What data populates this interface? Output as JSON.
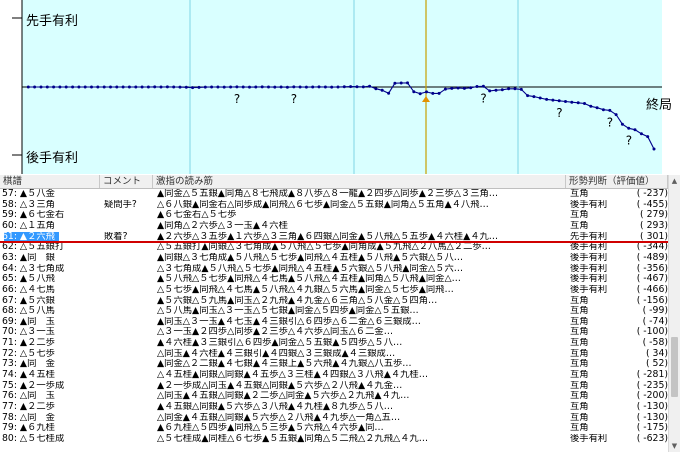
{
  "graph": {
    "top_label": "先手有利",
    "bottom_label": "後手有利",
    "end_label": "終局",
    "question_mark": "?",
    "background_color": "#d9ffff",
    "line_color": "#00008b",
    "points": [
      [
        1,
        0
      ],
      [
        2,
        0
      ],
      [
        3,
        0
      ],
      [
        4,
        0
      ],
      [
        5,
        0
      ],
      [
        6,
        0
      ],
      [
        7,
        0
      ],
      [
        8,
        0
      ],
      [
        9,
        0
      ],
      [
        10,
        0
      ],
      [
        11,
        0
      ],
      [
        12,
        0
      ],
      [
        13,
        0
      ],
      [
        14,
        0
      ],
      [
        15,
        0
      ],
      [
        16,
        0
      ],
      [
        17,
        0
      ],
      [
        18,
        0
      ],
      [
        19,
        0
      ],
      [
        20,
        0
      ],
      [
        21,
        5
      ],
      [
        22,
        0
      ],
      [
        23,
        10
      ],
      [
        24,
        0
      ],
      [
        25,
        -10
      ],
      [
        26,
        -20
      ],
      [
        27,
        -40
      ],
      [
        28,
        -30
      ],
      [
        29,
        -10
      ],
      [
        30,
        0
      ],
      [
        31,
        0
      ],
      [
        32,
        -10
      ],
      [
        33,
        0
      ],
      [
        34,
        5
      ],
      [
        35,
        0
      ],
      [
        36,
        -5
      ],
      [
        37,
        0
      ],
      [
        38,
        10
      ],
      [
        39,
        0
      ],
      [
        40,
        -10
      ],
      [
        41,
        0
      ],
      [
        42,
        -15
      ],
      [
        43,
        5
      ],
      [
        44,
        0
      ],
      [
        45,
        -10
      ],
      [
        46,
        0
      ],
      [
        47,
        10
      ],
      [
        48,
        0
      ],
      [
        49,
        -5
      ],
      [
        50,
        0
      ],
      [
        51,
        15
      ],
      [
        52,
        30
      ],
      [
        53,
        20
      ],
      [
        54,
        10
      ],
      [
        55,
        60
      ],
      [
        56,
        -120
      ],
      [
        57,
        -237
      ],
      [
        58,
        -455
      ],
      [
        59,
        279
      ],
      [
        60,
        293
      ],
      [
        61,
        301
      ],
      [
        62,
        -344
      ],
      [
        63,
        -489
      ],
      [
        64,
        -356
      ],
      [
        65,
        -467
      ],
      [
        66,
        -466
      ],
      [
        67,
        -156
      ],
      [
        68,
        -99
      ],
      [
        69,
        -74
      ],
      [
        70,
        -100
      ],
      [
        71,
        -58
      ],
      [
        72,
        34
      ],
      [
        73,
        52
      ],
      [
        74,
        -281
      ],
      [
        75,
        -235
      ],
      [
        76,
        -200
      ],
      [
        77,
        -130
      ],
      [
        78,
        -130
      ],
      [
        79,
        -175
      ],
      [
        80,
        -623
      ],
      [
        81,
        -700
      ],
      [
        82,
        -800
      ],
      [
        83,
        -900
      ],
      [
        84,
        -950
      ],
      [
        85,
        -1000
      ],
      [
        86,
        -1050
      ],
      [
        87,
        -1100
      ],
      [
        88,
        -1150
      ],
      [
        89,
        -1200
      ],
      [
        90,
        -1400
      ],
      [
        91,
        -1500
      ],
      [
        92,
        -1650
      ],
      [
        93,
        -1700
      ],
      [
        94,
        -2000
      ],
      [
        95,
        -2700
      ],
      [
        96,
        -3000
      ],
      [
        97,
        -3100
      ],
      [
        98,
        -3400
      ],
      [
        99,
        -3600
      ],
      [
        100,
        -4500
      ]
    ],
    "question_marks": [
      [
        34,
        -1
      ],
      [
        43,
        -1
      ],
      [
        73,
        -1
      ],
      [
        85,
        -1
      ],
      [
        93,
        -1
      ],
      [
        96,
        -1
      ]
    ],
    "current_move": 61
  },
  "table": {
    "headers": {
      "move": "棋譜",
      "comment": "コメント",
      "reading": "激指の読み筋",
      "judgement": "形勢判断（評価値）"
    },
    "rows": [
      {
        "move": "57: ▲５八金",
        "comment": "",
        "reading": "▲同金△５五銀▲同角△８七飛成▲８八歩△８一龍▲２四歩△同歩▲２三歩△３三角…",
        "judge": "互角",
        "value": "(  -237)"
      },
      {
        "move": "58: △３三角",
        "comment": "疑問手?",
        "reading": "△６八銀▲同金右△同歩成▲同飛△６七歩▲同金△５五銀▲同角△５五角▲４八飛…",
        "judge": "後手有利",
        "value": "(  -455)"
      },
      {
        "move": "59: ▲６七金右",
        "comment": "",
        "reading": "▲６七金右△５七歩",
        "judge": "互角",
        "value": "(   279)"
      },
      {
        "move": "60: △１五角",
        "comment": "",
        "reading": "▲同角△２六歩△３一玉▲４六桂",
        "judge": "互角",
        "value": "(   293)"
      },
      {
        "move": "61: ▲２六飛",
        "comment": "敗着?",
        "reading": "▲２六歩△３五歩▲１六歩△３三角▲６四銀△同金▲５八飛△５五歩▲４六桂▲４九…",
        "judge": "先手有利",
        "value": "(   301)"
      },
      {
        "move": "62: △５五銀打",
        "comment": "",
        "reading": "△５五銀打▲同銀△３七角成▲５八飛△５七歩▲同角成▲５九飛△２八馬△２二歩…",
        "judge": "後手有利",
        "value": "(  -344)"
      },
      {
        "move": "63: ▲同　銀",
        "comment": "",
        "reading": "▲同銀△３七角成▲５八飛△５七歩▲同飛△４五桂▲５八飛▲５六銀△５八…",
        "judge": "後手有利",
        "value": "(  -489)"
      },
      {
        "move": "64: △３七角成",
        "comment": "",
        "reading": "△３七角成▲５八飛△５七歩▲同飛△４五桂▲５六銀△５八飛▲同金△５六…",
        "judge": "後手有利",
        "value": "(  -356)"
      },
      {
        "move": "65: ▲５八飛",
        "comment": "",
        "reading": "▲５八飛△５七歩▲同飛△４七馬▲５八飛△４五桂▲同角△５八飛▲同金△…",
        "judge": "後手有利",
        "value": "(  -467)"
      },
      {
        "move": "66: △４七馬",
        "comment": "",
        "reading": "△５七歩▲同飛△４七馬▲５八飛△４九銀△５六馬▲同金△５七歩▲同飛…",
        "judge": "後手有利",
        "value": "(  -466)"
      },
      {
        "move": "67: ▲５六銀",
        "comment": "",
        "reading": "▲５六銀△５九馬▲同玉△２九飛▲４九金△６三角△５八金△５四角…",
        "judge": "互角",
        "value": "(  -156)"
      },
      {
        "move": "68: △５八馬",
        "comment": "",
        "reading": "△５八馬▲同玉△３一玉△５七銀▲同金△５四歩▲同金△５五銀…",
        "judge": "互角",
        "value": "(   -99)"
      },
      {
        "move": "69: ▲同　玉",
        "comment": "",
        "reading": "▲同玉△３一玉▲４七玉▲４三銀引△６四歩△６二金△６三銀成…",
        "judge": "互角",
        "value": "(   -74)"
      },
      {
        "move": "70: △３一玉",
        "comment": "",
        "reading": "△３一玉▲２四歩△同歩▲２三歩△４六歩△同玉△６二金…",
        "judge": "互角",
        "value": "(  -100)"
      },
      {
        "move": "71: ▲２二歩",
        "comment": "",
        "reading": "▲４六桂▲３三銀引△６四歩▲同金△５五銀▲５四歩△５八…",
        "judge": "互角",
        "value": "(   -58)"
      },
      {
        "move": "72: △５七歩",
        "comment": "",
        "reading": "△同玉▲４六桂▲４三銀引▲４四銀△３三銀成▲４三銀成…",
        "judge": "互角",
        "value": "(    34)"
      },
      {
        "move": "73: ▲同　金",
        "comment": "",
        "reading": "▲同金△２二銀▲４七銀▲４三銀上▲５六飛▲４九銀△八五歩…",
        "judge": "互角",
        "value": "(    52)"
      },
      {
        "move": "74: ▲４五桂",
        "comment": "",
        "reading": "△４五桂▲同銀△同銀▲４五歩△３三桂▲４四銀△３八飛▲４九桂…",
        "judge": "互角",
        "value": "(  -281)"
      },
      {
        "move": "75: ▲２一歩成",
        "comment": "",
        "reading": "▲２一歩成△同玉▲４五銀△同銀▲５六歩△２八飛▲４九金…",
        "judge": "互角",
        "value": "(  -235)"
      },
      {
        "move": "76: △同　玉",
        "comment": "",
        "reading": "△同玉▲４五銀△同銀▲２二歩△同金▲５六歩△２九飛▲４九…",
        "judge": "互角",
        "value": "(  -200)"
      },
      {
        "move": "77: ▲２二歩",
        "comment": "",
        "reading": "▲４五銀△同銀▲５六歩△３八飛▲４九桂▲８九歩△５八…",
        "judge": "互角",
        "value": "(  -130)"
      },
      {
        "move": "78: △同　金",
        "comment": "",
        "reading": "△同金▲４五銀△同銀▲５六歩△２八飛▲４九歩△一角△五…",
        "judge": "互角",
        "value": "(  -130)"
      },
      {
        "move": "79: ▲６九桂",
        "comment": "",
        "reading": "▲６九桂△５四歩▲同飛△５三歩▲５六飛△４六歩▲同…",
        "judge": "互角",
        "value": "(  -175)"
      },
      {
        "move": "80: △５七桂成",
        "comment": "",
        "reading": "△５七桂成▲同桂△６七歩▲５五銀▲同角△５二飛△２九飛△４九…",
        "judge": "後手有利",
        "value": "(  -623)"
      }
    ]
  }
}
